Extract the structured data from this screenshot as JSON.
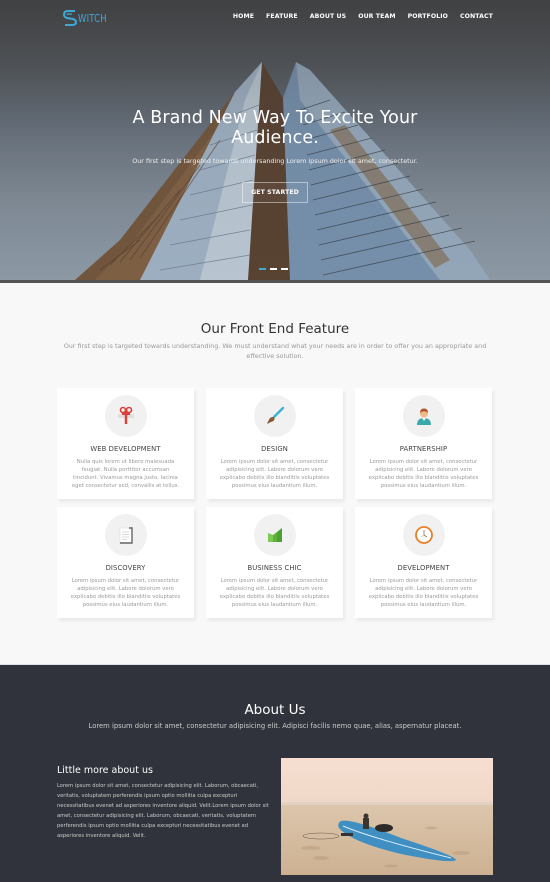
{
  "nav": {
    "logo_text": "WITCH",
    "logo_mark": "S",
    "items": [
      {
        "label": "HOME"
      },
      {
        "label": "FEATURE"
      },
      {
        "label": "ABOUT US"
      },
      {
        "label": "OUR TEAM"
      },
      {
        "label": "PORTFOLIO"
      },
      {
        "label": "CONTACT"
      }
    ]
  },
  "hero": {
    "title": "A Brand New Way To Excite Your Audience.",
    "subtitle": "Our first step is targeted towards undersanding Lorem ipsum dolor sit amet, consectetur.",
    "cta_label": "GET STARTED",
    "slides_total": 3,
    "active_slide": 1,
    "background_image": "skyscraper-building-photo"
  },
  "features": {
    "title": "Our Front End Feature",
    "subtitle": "Our first step is targeted towards understanding. We must understand what your needs are in order to offer you an appropriate and effective solution.",
    "cards": [
      {
        "icon": "gift-icon",
        "title": "WEB DEVELOPMENT",
        "text": "Nulla quis lorem ut libero malesuada feugiat. Nulla porttitor accumsan tincidunt. Vivamus magna justo, lacinia eget consectetur sed, convallis at tellus."
      },
      {
        "icon": "paintbrush-icon",
        "title": "DESIGN",
        "text": "Lorem ipsum dolor sit amet, consectetur adipisicing elit. Labore dolorum vero explicabo debitis illo blanditiis voluptates possimus eius laudantium illum."
      },
      {
        "icon": "person-icon",
        "title": "PARTNERSHIP",
        "text": "Lorem ipsum dolor sit amet, consectetur adipisicing elit. Labore dolorum vero explicabo debitis illo blanditiis voluptates possimus eius laudantium illum."
      },
      {
        "icon": "document-icon",
        "title": "DISCOVERY",
        "text": "Lorem ipsum dolor sit amet, consectetur adipisicing elit. Labore dolorum vero explicabo debitis illo blanditiis voluptates possimus eius laudantium illum."
      },
      {
        "icon": "chart-icon",
        "title": "BUSINESS CHIC",
        "text": "Lorem ipsum dolor sit amet, consectetur adipisicing elit. Labore dolorum vero explicabo debitis illo blanditiis voluptates possimus eius laudantium illum."
      },
      {
        "icon": "clock-icon",
        "title": "DEVELOPMENT",
        "text": "Lorem ipsum dolor sit amet, consectetur adipisicing elit. Labore dolorum vero explicabo debitis illo blanditiis voluptates possimus eius laudantium illum."
      }
    ]
  },
  "about": {
    "title": "About Us",
    "subtitle": "Lorem ipsum dolor sit amet, consectetur adipisicing elit. Adipisci facilis nemo quae, alias, aspernatur placeat.",
    "more_title": "Little more about us",
    "more_text": "Lorem ipsum dolor sit amet, consectetur adipisicing elit. Laborum, obcaecati, veritatis, voluptatem perferendis ipsum optio mollitia culpa excepturi necessitatibus evenet ad asperiores inventore aliquid. Velit.Lorem ipsum dolor sit amet, consectetur adipisicing elit. Laborum, obcaecati, veritatis, voluptatem perferendis ipsum optio mollitia culpa excepturi necessitatibus evenet ad asperiores inventore aliquid. Velit.",
    "image": "surfboard-on-beach-photo"
  },
  "colors": {
    "accent": "#3fa9d8",
    "dark_section": "#30333b",
    "light_section": "#f8f8f8"
  }
}
